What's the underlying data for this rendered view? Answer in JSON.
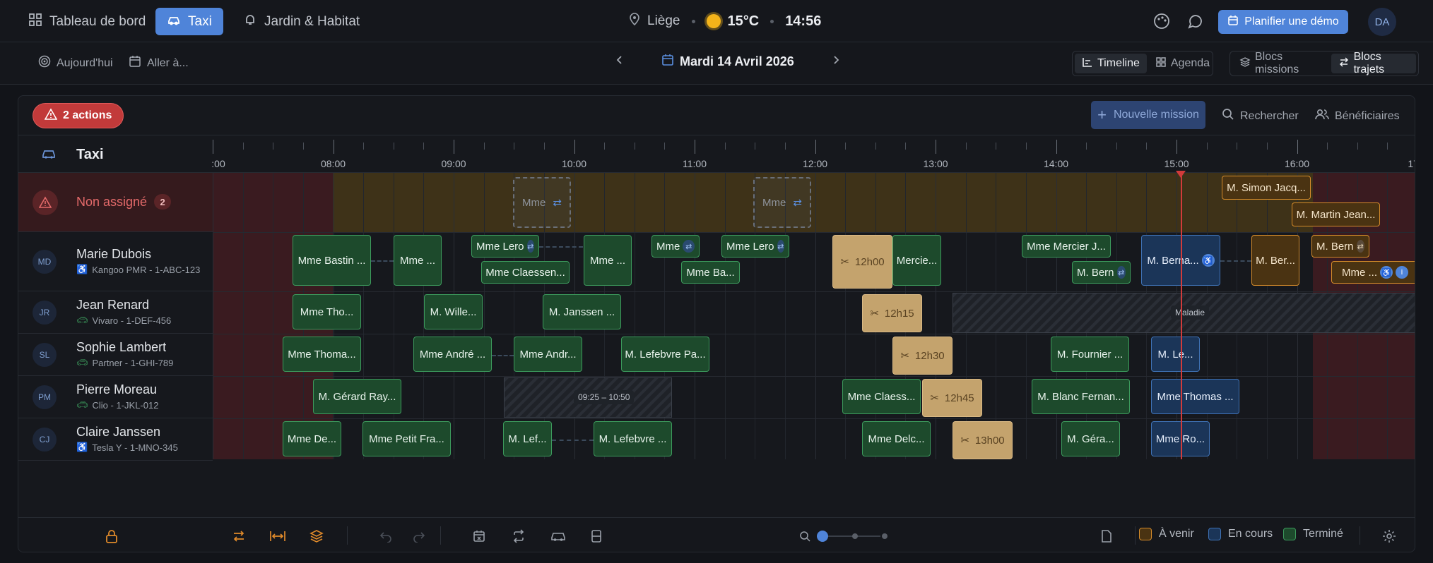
{
  "nav": {
    "tabs": [
      {
        "label": "Tableau de bord",
        "icon": "dashboard-icon"
      },
      {
        "label": "Taxi",
        "icon": "car-icon",
        "active": true
      },
      {
        "label": "Jardin & Habitat",
        "icon": "bell-icon"
      }
    ],
    "location": "Liège",
    "temperature": "15°C",
    "time": "14:56",
    "demo_label": "Planifier une démo",
    "avatar": "DA"
  },
  "toolbar": {
    "today": "Aujourd'hui",
    "goto": "Aller à...",
    "date": "Mardi 14 Avril 2026",
    "views": [
      "Timeline",
      "Agenda"
    ],
    "blocks": [
      "Blocs missions",
      "Blocs trajets"
    ]
  },
  "panel": {
    "actions": "2 actions",
    "new_mission": "Nouvelle mission",
    "search": "Rechercher",
    "beneficiaries": "Bénéficiaires",
    "group": "Taxi"
  },
  "timeline": {
    "hours": [
      ":00",
      "08:00",
      "09:00",
      "10:00",
      "11:00",
      "12:00",
      "13:00",
      "14:00",
      "15:00",
      "16:00",
      "17:0"
    ],
    "current_time": "14:56"
  },
  "rows": [
    {
      "key": "unassigned",
      "label": "Non assigné",
      "count": "2"
    },
    {
      "initials": "MD",
      "name": "Marie Dubois",
      "vehicle": "Kangoo PMR - 1-ABC-123",
      "vehicle_icon": "wheelchair-icon"
    },
    {
      "initials": "JR",
      "name": "Jean Renard",
      "vehicle": "Vivaro - 1-DEF-456",
      "vehicle_icon": "car-icon"
    },
    {
      "initials": "SL",
      "name": "Sophie Lambert",
      "vehicle": "Partner - 1-GHI-789",
      "vehicle_icon": "car-icon"
    },
    {
      "initials": "PM",
      "name": "Pierre Moreau",
      "vehicle": "Clio - 1-JKL-012",
      "vehicle_icon": "car-icon"
    },
    {
      "initials": "CJ",
      "name": "Claire Janssen",
      "vehicle": "Tesla Y - 1-MNO-345",
      "vehicle_icon": "wheelchair-icon"
    }
  ],
  "blocks": {
    "unassigned": [
      {
        "label": "Mme",
        "status": "dashed"
      },
      {
        "label": "Mme",
        "status": "dashed"
      },
      {
        "label": "M. Simon Jacq...",
        "status": "upcoming"
      },
      {
        "label": "M. Martin Jean...",
        "status": "upcoming"
      }
    ],
    "marie": [
      {
        "label": "Mme Bastin ...",
        "status": "done"
      },
      {
        "label": "Mme ...",
        "status": "done"
      },
      {
        "label": "Mme Lero",
        "status": "done"
      },
      {
        "label": "Mme Claessen...",
        "status": "done"
      },
      {
        "label": "Mme ...",
        "status": "done"
      },
      {
        "label": "Mme",
        "status": "done"
      },
      {
        "label": "Mme Ba...",
        "status": "done"
      },
      {
        "label": "Mme Lero",
        "status": "done"
      },
      {
        "label": "12h00",
        "status": "pause"
      },
      {
        "label": "Mercie...",
        "status": "done"
      },
      {
        "label": "Mme Mercier J...",
        "status": "done"
      },
      {
        "label": "M. Bern",
        "status": "done"
      },
      {
        "label": "M. Berna...",
        "status": "ongoing"
      },
      {
        "label": "M. Ber...",
        "status": "upcoming"
      },
      {
        "label": "M. Bern",
        "status": "upcoming"
      },
      {
        "label": "Mme ...",
        "status": "upcoming"
      }
    ],
    "jean": [
      {
        "label": "Mme Tho...",
        "status": "done"
      },
      {
        "label": "M. Wille...",
        "status": "done"
      },
      {
        "label": "M. Janssen ...",
        "status": "done"
      },
      {
        "label": "12h15",
        "status": "pause"
      },
      {
        "label": "Maladie",
        "status": "absence"
      }
    ],
    "sophie": [
      {
        "label": "Mme Thoma...",
        "status": "done"
      },
      {
        "label": "Mme André ...",
        "status": "done"
      },
      {
        "label": "Mme Andr...",
        "status": "done"
      },
      {
        "label": "M. Lefebvre Pa...",
        "status": "done"
      },
      {
        "label": "12h30",
        "status": "pause"
      },
      {
        "label": "M. Fournier ...",
        "status": "done"
      },
      {
        "label": "M. Le...",
        "status": "ongoing"
      }
    ],
    "pierre": [
      {
        "label": "M. Gérard Ray...",
        "status": "done"
      },
      {
        "label": "09:25 – 10:50",
        "status": "absence"
      },
      {
        "label": "Mme Claess...",
        "status": "done"
      },
      {
        "label": "12h45",
        "status": "pause"
      },
      {
        "label": "M. Blanc Fernan...",
        "status": "done"
      },
      {
        "label": "Mme Thomas ...",
        "status": "ongoing"
      }
    ],
    "claire": [
      {
        "label": "Mme De...",
        "status": "done"
      },
      {
        "label": "Mme Petit Fra...",
        "status": "done"
      },
      {
        "label": "M. Lef...",
        "status": "done"
      },
      {
        "label": "M. Lefebvre ...",
        "status": "done"
      },
      {
        "label": "Mme Delc...",
        "status": "done"
      },
      {
        "label": "13h00",
        "status": "pause"
      },
      {
        "label": "M. Géra...",
        "status": "done"
      },
      {
        "label": "Mme Ro...",
        "status": "ongoing"
      }
    ]
  },
  "legend": [
    {
      "label": "À venir",
      "color": "#d48b2a"
    },
    {
      "label": "En cours",
      "color": "#3f72b5"
    },
    {
      "label": "Terminé",
      "color": "#3c9a5c"
    }
  ],
  "zoom": {
    "level": 0
  }
}
